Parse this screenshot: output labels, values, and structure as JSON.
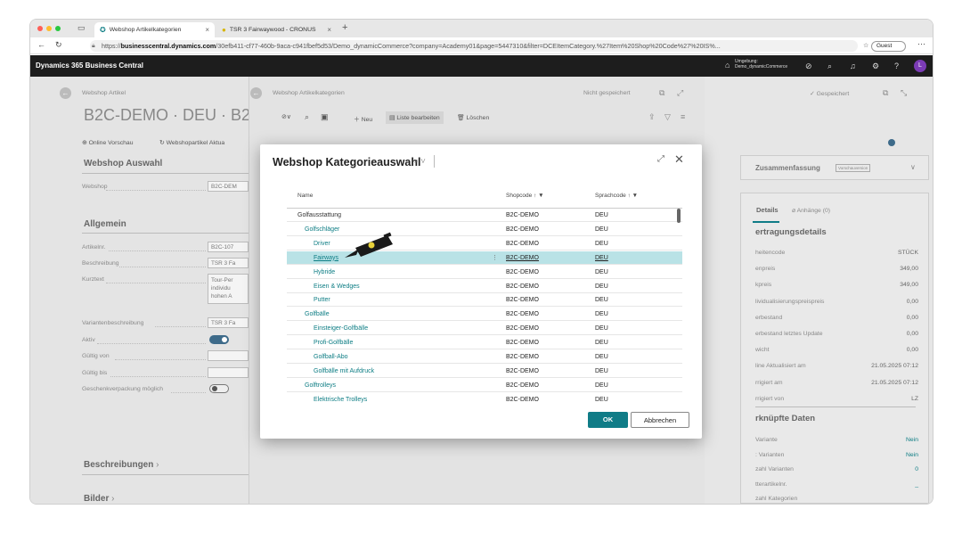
{
  "browser": {
    "tabs": [
      {
        "label": "Webshop Artikelkategorien"
      },
      {
        "label": "TSR 3 Fairwaywood - CRONUS"
      }
    ],
    "url_prefix": "https://",
    "url_host": "businesscentral.dynamics.com",
    "url_path": "/30efb411-cf77-460b-9aca-c941fbef5d53/Demo_dynamicCommerce?company=Academy01&page=5447310&filter=DCEItemCategory.%27Item%20Shop%20Code%27%20IS%...",
    "guest_label": "Guest"
  },
  "app": {
    "title": "Dynamics 365 Business Central",
    "env_label": "Umgebung:",
    "env_name": "Demo_dynamicCommerce",
    "avatar": "L"
  },
  "left": {
    "breadcrumb": "Webshop Artikel",
    "title": "B2C-DEMO · DEU · B2C-",
    "actions": [
      "Online Vorschau",
      "Webshopartikel Aktua"
    ],
    "section1": "Webshop Auswahl",
    "webshop_label": "Webshop",
    "webshop_value": "B2C-DEM",
    "section2": "Allgemein",
    "fields": [
      {
        "label": "Artikelnr.",
        "value": "B2C-107"
      },
      {
        "label": "Beschreibung",
        "value": "TSR 3 Fa"
      },
      {
        "label": "Kurztext",
        "value": "Tour-Per"
      }
    ],
    "kurztext_extra": [
      "individu",
      "hohen A"
    ],
    "fields2": [
      {
        "label": "Variantenbeschreibung",
        "value": "TSR 3 Fa"
      },
      {
        "label": "Aktiv"
      },
      {
        "label": "Gültig von"
      },
      {
        "label": "Gültig bis"
      },
      {
        "label": "Geschenkverpackung möglich"
      }
    ],
    "section3": "Beschreibungen",
    "section4": "Bilder"
  },
  "middle": {
    "breadcrumb": "Webshop Artikelkategorien",
    "status": "Nicht gespeichert",
    "new_label": "Neu",
    "edit_list_label": "Liste bearbeiten",
    "delete_label": "Löschen"
  },
  "right": {
    "status": "Gespeichert",
    "summary": "Zusammenfassung",
    "summary_badge": "Vorschauversion",
    "tab_details": "Details",
    "tab_attachments": "Anhänge (0)",
    "heading1": "ertragungsdetails",
    "rows": [
      {
        "label": "heitencode",
        "value": "STÜCK"
      },
      {
        "label": "enpreis",
        "value": "349,00"
      },
      {
        "label": "kpreis",
        "value": "349,00"
      },
      {
        "label": "lividualisierungspreispreis",
        "value": "0,00"
      },
      {
        "label": "erbestand",
        "value": "0,00"
      },
      {
        "label": "erbestand letztes Update",
        "value": "0,00"
      },
      {
        "label": "wicht",
        "value": "0,00"
      },
      {
        "label": "line Aktualisiert am",
        "value": "21.05.2025 07:12"
      },
      {
        "label": "rrigiert am",
        "value": "21.05.2025 07:12"
      },
      {
        "label": "rrigiert von",
        "value": "LZ"
      }
    ],
    "heading2": "rknüpfte Daten",
    "rows2": [
      {
        "label": "Variante",
        "value": "Nein"
      },
      {
        "label": ": Varianten",
        "value": "Nein"
      },
      {
        "label": "zahl Varianten",
        "value": "0"
      },
      {
        "label": "tterartikelnr.",
        "value": "_"
      },
      {
        "label": "zahl Kategorien",
        "value": ""
      }
    ]
  },
  "dialog": {
    "title": "Webshop Kategorieauswahl",
    "columns": {
      "name": "Name",
      "shopcode": "Shopcode ↑",
      "sprachcode": "Sprachcode ↑"
    },
    "rows": [
      {
        "name": "Golfausstattung",
        "shop": "B2C-DEMO",
        "lang": "DEU",
        "level": 0
      },
      {
        "name": "Golfschläger",
        "shop": "B2C-DEMO",
        "lang": "DEU",
        "level": 1
      },
      {
        "name": "Driver",
        "shop": "B2C-DEMO",
        "lang": "DEU",
        "level": 2
      },
      {
        "name": "Fairways",
        "shop": "B2C-DEMO",
        "lang": "DEU",
        "level": 2,
        "selected": true
      },
      {
        "name": "Hybride",
        "shop": "B2C-DEMO",
        "lang": "DEU",
        "level": 2
      },
      {
        "name": "Eisen & Wedges",
        "shop": "B2C-DEMO",
        "lang": "DEU",
        "level": 2
      },
      {
        "name": "Putter",
        "shop": "B2C-DEMO",
        "lang": "DEU",
        "level": 2
      },
      {
        "name": "Golfbälle",
        "shop": "B2C-DEMO",
        "lang": "DEU",
        "level": 1
      },
      {
        "name": "Einsteiger-Golfbälle",
        "shop": "B2C-DEMO",
        "lang": "DEU",
        "level": 2
      },
      {
        "name": "Profi-Golfbälle",
        "shop": "B2C-DEMO",
        "lang": "DEU",
        "level": 2
      },
      {
        "name": "Golfball-Abo",
        "shop": "B2C-DEMO",
        "lang": "DEU",
        "level": 2
      },
      {
        "name": "Golfbälle mit Aufdruck",
        "shop": "B2C-DEMO",
        "lang": "DEU",
        "level": 2
      },
      {
        "name": "Golftrolleys",
        "shop": "B2C-DEMO",
        "lang": "DEU",
        "level": 1
      },
      {
        "name": "Elektrische Trolleys",
        "shop": "B2C-DEMO",
        "lang": "DEU",
        "level": 2
      }
    ],
    "ok": "OK",
    "cancel": "Abbrechen"
  },
  "colors": {
    "accent": "#107c87",
    "link": "#0d7d84",
    "selected_row": "#b9e2e6",
    "header_bg": "#1d1d1d"
  }
}
